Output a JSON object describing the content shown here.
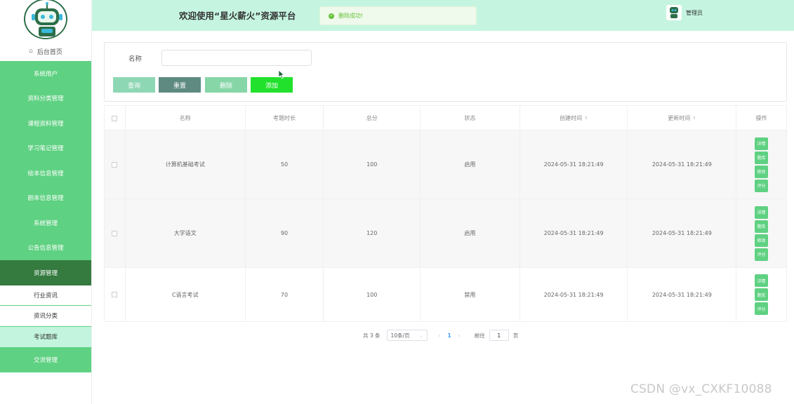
{
  "header": {
    "welcome": "欢迎使用“星火薪火”资源平台",
    "admin_label": "管理员"
  },
  "toast": {
    "message": "删除成功!"
  },
  "sidebar": {
    "home_label": "后台首页",
    "items": [
      {
        "label": "系统用户"
      },
      {
        "label": "资料分类管理"
      },
      {
        "label": "课程资料管理"
      },
      {
        "label": "学习笔记管理"
      },
      {
        "label": "绘本信息管理"
      },
      {
        "label": "剧本信息管理"
      },
      {
        "label": "系统管理"
      },
      {
        "label": "公告信息管理"
      },
      {
        "label": "资源管理"
      }
    ],
    "subitems": [
      {
        "label": "行业资讯"
      },
      {
        "label": "资讯分类"
      },
      {
        "label": "考试题库"
      }
    ],
    "last_item": {
      "label": "交流管理"
    }
  },
  "search": {
    "label": "名称",
    "value": "",
    "buttons": {
      "query": "查询",
      "reset": "重置",
      "delete": "删除",
      "add": "添加"
    }
  },
  "table": {
    "headers": [
      "名称",
      "考题时长",
      "总分",
      "状态",
      "创建时间",
      "更新时间",
      "操作"
    ],
    "rows": [
      {
        "name": "计算机基础考试",
        "duration": "50",
        "score": "100",
        "status": "启用",
        "created": "2024-05-31 18:21:49",
        "updated": "2024-05-31 18:21:49",
        "ops": [
          "详情",
          "题库",
          "修改",
          "评分"
        ]
      },
      {
        "name": "大学语文",
        "duration": "90",
        "score": "120",
        "status": "启用",
        "created": "2024-05-31 18:21:49",
        "updated": "2024-05-31 18:21:49",
        "ops": [
          "详情",
          "题库",
          "修改",
          "评分"
        ]
      },
      {
        "name": "C语言考试",
        "duration": "70",
        "score": "100",
        "status": "禁用",
        "created": "2024-05-31 18:21:49",
        "updated": "2024-05-31 18:21:49",
        "ops": [
          "详情",
          "题库",
          "评分"
        ]
      }
    ]
  },
  "pagination": {
    "total": "共 3 条",
    "page_size": "10条/页",
    "current_page": "1",
    "goto_label": "前往",
    "goto_value": "1",
    "page_suffix": "页"
  },
  "watermark": "CSDN @vx_CXKF10088"
}
